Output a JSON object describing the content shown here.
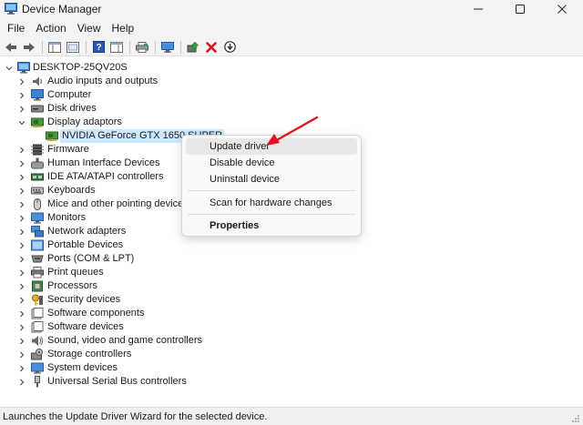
{
  "window": {
    "title": "Device Manager",
    "controls": [
      "minimize",
      "maximize",
      "close"
    ]
  },
  "menu": [
    "File",
    "Action",
    "View",
    "Help"
  ],
  "toolbar": {
    "buttons": [
      "back-icon",
      "forward-icon",
      "console-tree-icon",
      "properties-sheet-icon",
      "help-icon",
      "action-pane-icon",
      "print-icon",
      "monitor-icon",
      "update-driver-icon",
      "uninstall-icon",
      "download-icon"
    ]
  },
  "tree": {
    "root": "DESKTOP-25QV20S",
    "categories": [
      {
        "label": "Audio inputs and outputs",
        "icon": "audio-icon",
        "expanded": false
      },
      {
        "label": "Computer",
        "icon": "computer-icon",
        "expanded": false
      },
      {
        "label": "Disk drives",
        "icon": "disk-icon",
        "expanded": false
      },
      {
        "label": "Display adaptors",
        "icon": "display-adapter-icon",
        "expanded": true,
        "children": [
          {
            "label": "NVIDIA GeForce GTX 1650 SUPER",
            "icon": "gpu-icon",
            "selected": true
          }
        ]
      },
      {
        "label": "Firmware",
        "icon": "firmware-icon",
        "expanded": false
      },
      {
        "label": "Human Interface Devices",
        "icon": "hid-icon",
        "expanded": false
      },
      {
        "label": "IDE ATA/ATAPI controllers",
        "icon": "ide-icon",
        "expanded": false
      },
      {
        "label": "Keyboards",
        "icon": "keyboard-icon",
        "expanded": false
      },
      {
        "label": "Mice and other pointing devices",
        "icon": "mouse-icon",
        "expanded": false
      },
      {
        "label": "Monitors",
        "icon": "monitor-icon",
        "expanded": false
      },
      {
        "label": "Network adapters",
        "icon": "network-icon",
        "expanded": false
      },
      {
        "label": "Portable Devices",
        "icon": "portable-device-icon",
        "expanded": false
      },
      {
        "label": "Ports (COM & LPT)",
        "icon": "ports-icon",
        "expanded": false
      },
      {
        "label": "Print queues",
        "icon": "printer-icon",
        "expanded": false
      },
      {
        "label": "Processors",
        "icon": "processor-icon",
        "expanded": false
      },
      {
        "label": "Security devices",
        "icon": "security-icon",
        "expanded": false
      },
      {
        "label": "Software components",
        "icon": "software-component-icon",
        "expanded": false
      },
      {
        "label": "Software devices",
        "icon": "software-device-icon",
        "expanded": false
      },
      {
        "label": "Sound, video and game controllers",
        "icon": "sound-icon",
        "expanded": false
      },
      {
        "label": "Storage controllers",
        "icon": "storage-icon",
        "expanded": false
      },
      {
        "label": "System devices",
        "icon": "system-icon",
        "expanded": false
      },
      {
        "label": "Universal Serial Bus controllers",
        "icon": "usb-icon",
        "expanded": false
      }
    ]
  },
  "context_menu": {
    "items": [
      {
        "label": "Update driver",
        "hover": true
      },
      {
        "label": "Disable device"
      },
      {
        "label": "Uninstall device"
      },
      {
        "separator": true
      },
      {
        "label": "Scan for hardware changes"
      },
      {
        "separator": true
      },
      {
        "label": "Properties",
        "bold": true
      }
    ]
  },
  "status_bar": {
    "text": "Launches the Update Driver Wizard for the selected device."
  },
  "colors": {
    "chrome": "#f3f3f3",
    "selection": "#cce8ff",
    "menu_hover": "#e8e8e8",
    "annotation_arrow": "#e0141e",
    "help_icon": "#2b55b8",
    "delete_icon": "#d8141e"
  }
}
